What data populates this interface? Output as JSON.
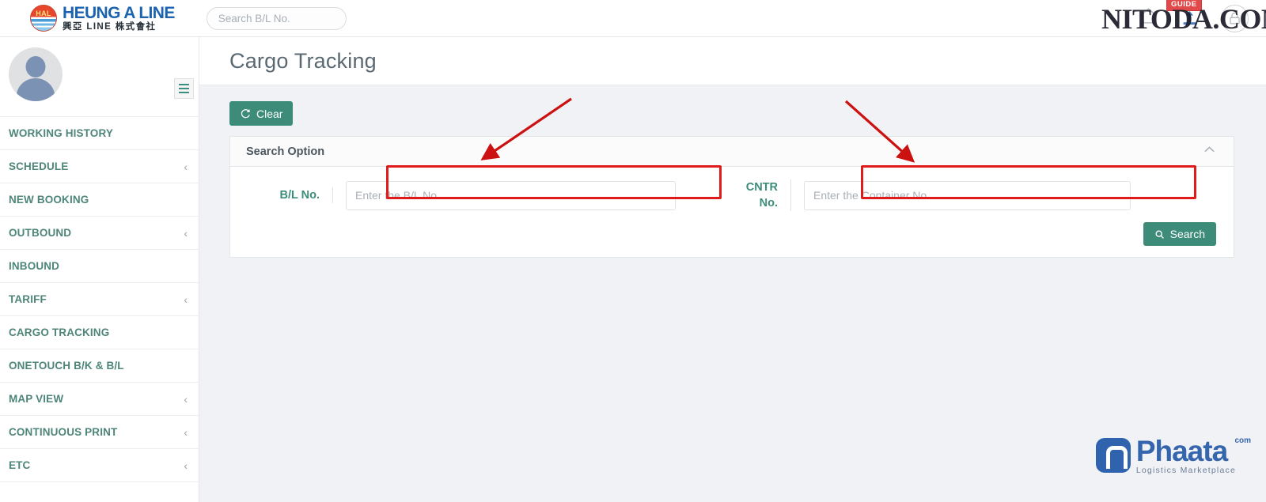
{
  "header": {
    "brand_en": "HEUNG A LINE",
    "brand_kr": "興亞 LINE 株式會社",
    "brand_mark_text": "HAL",
    "search_placeholder": "Search B/L No.",
    "search_value": "",
    "guide_badge": "GUIDE",
    "watermark": "NITODA.COM"
  },
  "sidebar": {
    "items": [
      {
        "label": "WORKING HISTORY",
        "chevron": ""
      },
      {
        "label": "SCHEDULE",
        "chevron": "‹"
      },
      {
        "label": "NEW BOOKING",
        "chevron": ""
      },
      {
        "label": "OUTBOUND",
        "chevron": "‹"
      },
      {
        "label": "INBOUND",
        "chevron": ""
      },
      {
        "label": "TARIFF",
        "chevron": "‹"
      },
      {
        "label": "CARGO TRACKING",
        "chevron": ""
      },
      {
        "label": "ONETOUCH B/K & B/L",
        "chevron": ""
      },
      {
        "label": "MAP VIEW",
        "chevron": "‹"
      },
      {
        "label": "CONTINUOUS PRINT",
        "chevron": "‹"
      },
      {
        "label": "ETC",
        "chevron": "‹"
      }
    ]
  },
  "main": {
    "page_title": "Cargo Tracking",
    "clear_label": "Clear",
    "panel_title": "Search Option",
    "fields": {
      "bl_label": "B/L No.",
      "bl_placeholder": "Enter the B/L No.",
      "bl_value": "",
      "cntr_label": "CNTR No.",
      "cntr_placeholder": "Enter the Container No.",
      "cntr_value": ""
    },
    "search_label": "Search"
  },
  "footer": {
    "phaata_name": "Phaata",
    "phaata_com": "com",
    "phaata_tagline": "Logistics  Marketplace"
  },
  "colors": {
    "accent_teal": "#3d8c7a",
    "sidebar_text": "#4e8579",
    "brand_blue": "#1b63b0",
    "annotation_red": "#e01b1b",
    "guide_red": "#e04a4a",
    "phaata_blue": "#3565ad"
  }
}
